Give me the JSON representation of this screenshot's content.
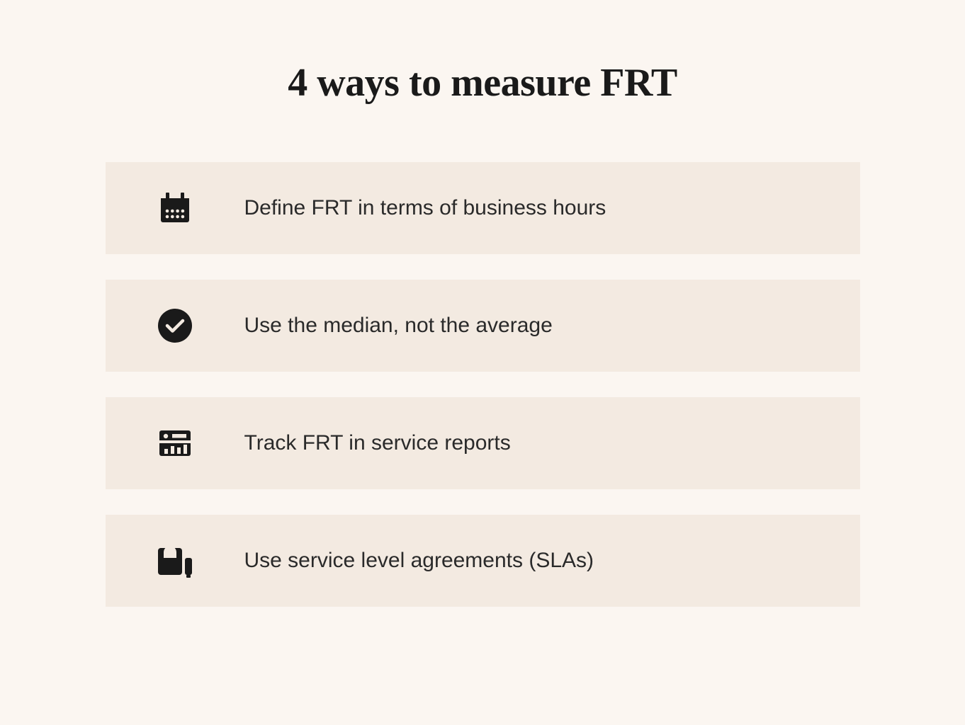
{
  "title": "4 ways to measure FRT",
  "items": [
    {
      "icon": "calendar-icon",
      "text": "Define FRT in terms of business hours"
    },
    {
      "icon": "check-circle-icon",
      "text": "Use the median, not the average"
    },
    {
      "icon": "dashboard-icon",
      "text": "Track FRT in service reports"
    },
    {
      "icon": "sla-icon",
      "text": "Use service level agreements (SLAs)"
    }
  ]
}
